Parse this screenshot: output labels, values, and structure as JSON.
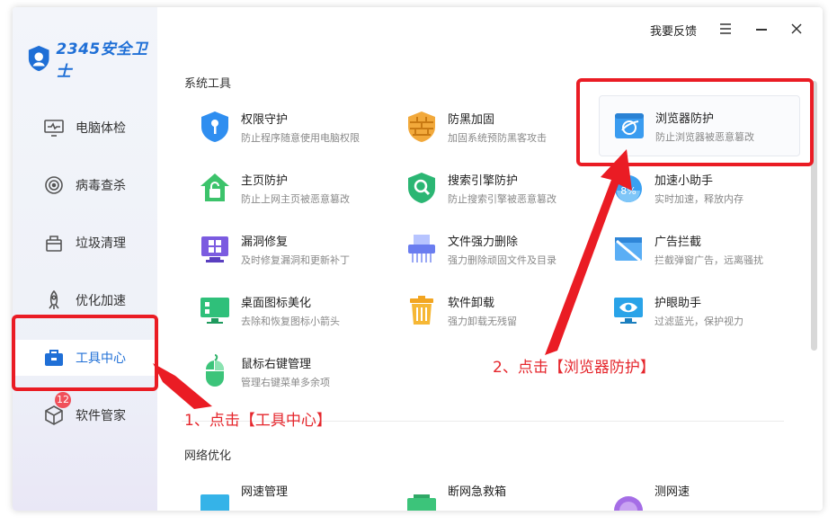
{
  "app": {
    "logo_text": "2345安全卫士",
    "feedback_label": "我要反馈"
  },
  "sidebar": {
    "items": [
      {
        "label": "电脑体检",
        "icon": "monitor-pulse-icon"
      },
      {
        "label": "病毒查杀",
        "icon": "target-icon"
      },
      {
        "label": "垃圾清理",
        "icon": "trash-bin-icon"
      },
      {
        "label": "优化加速",
        "icon": "rocket-icon"
      },
      {
        "label": "工具中心",
        "icon": "toolbox-icon",
        "active": true
      },
      {
        "label": "软件管家",
        "icon": "package-icon",
        "badge": "12"
      }
    ]
  },
  "sections": {
    "system_tools": "系统工具",
    "network": "网络优化"
  },
  "tools": [
    {
      "title": "权限守护",
      "desc": "防止程序随意使用电脑权限",
      "icon": "shield-key-icon"
    },
    {
      "title": "防黑加固",
      "desc": "加固系统预防黑客攻击",
      "icon": "firewall-icon"
    },
    {
      "title": "浏览器防护",
      "desc": "防止浏览器被恶意篡改",
      "icon": "browser-shield-icon"
    },
    {
      "title": "主页防护",
      "desc": "防止上网主页被恶意篡改",
      "icon": "home-lock-icon"
    },
    {
      "title": "搜索引擎防护",
      "desc": "防止搜索引擎被恶意篡改",
      "icon": "search-shield-icon"
    },
    {
      "title": "加速小助手",
      "desc": "实时加速，释放内存",
      "icon": "speed-ball-icon"
    },
    {
      "title": "漏洞修复",
      "desc": "及时修复漏洞和更新补丁",
      "icon": "windows-patch-icon"
    },
    {
      "title": "文件强力删除",
      "desc": "强力删除顽固文件及目录",
      "icon": "shredder-icon"
    },
    {
      "title": "广告拦截",
      "desc": "拦截弹窗广告，远离骚扰",
      "icon": "ad-block-icon"
    },
    {
      "title": "桌面图标美化",
      "desc": "去除和恢复图标小箭头",
      "icon": "desktop-icon"
    },
    {
      "title": "软件卸载",
      "desc": "强力卸载无残留",
      "icon": "uninstall-bin-icon"
    },
    {
      "title": "护眼助手",
      "desc": "过滤蓝光，保护视力",
      "icon": "eye-monitor-icon"
    },
    {
      "title": "鼠标右键管理",
      "desc": "管理右键菜单多余项",
      "icon": "mouse-icon"
    }
  ],
  "network_tools": [
    {
      "title": "网速管理",
      "icon": "net-speed-icon"
    },
    {
      "title": "断网急救箱",
      "icon": "first-aid-icon"
    },
    {
      "title": "测网速",
      "icon": "speed-test-icon"
    }
  ],
  "annotations": {
    "step1": "1、点击【工具中心】",
    "step2": "2、点击【浏览器防护】"
  },
  "colors": {
    "accent": "#1f6fd6",
    "annotation_red": "#ea1c24"
  }
}
